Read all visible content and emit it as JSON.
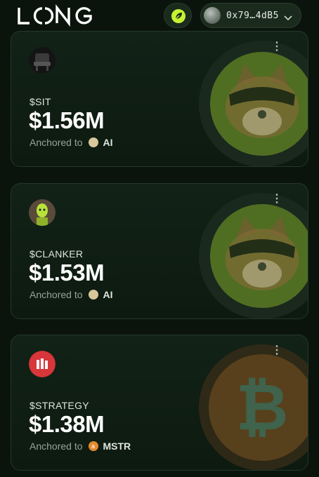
{
  "header": {
    "logo_text": "LONG",
    "action_icon": "leaf-icon",
    "wallet_address": "0x79…4dB5",
    "wallet_icon": "chevron-down-icon"
  },
  "cards": [
    {
      "ticker": "$SIT",
      "value": "$1.56M",
      "anchored_label": "Anchored to",
      "anchor_name": "AI",
      "background_icon": "dog-mascot-icon"
    },
    {
      "ticker": "$CLANKER",
      "value": "$1.53M",
      "anchored_label": "Anchored to",
      "anchor_name": "AI",
      "background_icon": "dog-mascot-icon"
    },
    {
      "ticker": "$STRATEGY",
      "value": "$1.38M",
      "anchored_label": "Anchored to",
      "anchor_name": "MSTR",
      "anchor_icon_letter": "a",
      "background_icon": "bitcoin-icon"
    }
  ],
  "colors": {
    "accent_green": "#c6f232",
    "strategy_red": "#d8363a",
    "bitcoin_orange": "#e48a2c",
    "background": "#0a140c"
  }
}
